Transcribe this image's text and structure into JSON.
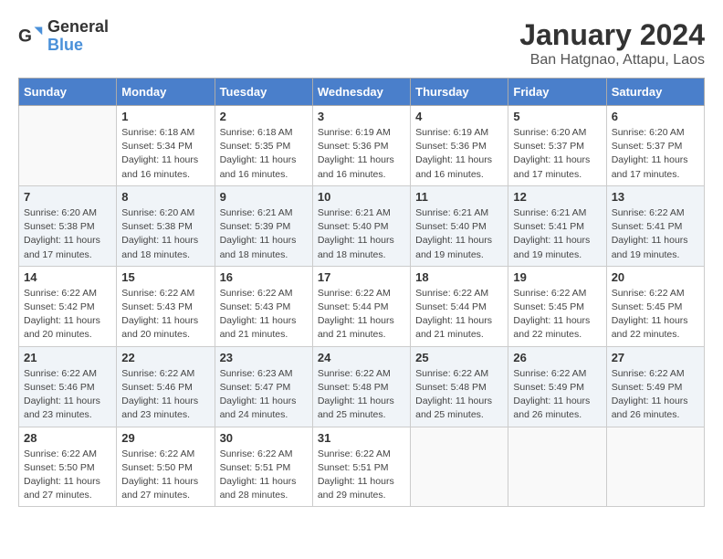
{
  "header": {
    "logo_general": "General",
    "logo_blue": "Blue",
    "month": "January 2024",
    "location": "Ban Hatgnao, Attapu, Laos"
  },
  "weekdays": [
    "Sunday",
    "Monday",
    "Tuesday",
    "Wednesday",
    "Thursday",
    "Friday",
    "Saturday"
  ],
  "weeks": [
    [
      {
        "day": "",
        "info": ""
      },
      {
        "day": "1",
        "info": "Sunrise: 6:18 AM\nSunset: 5:34 PM\nDaylight: 11 hours\nand 16 minutes."
      },
      {
        "day": "2",
        "info": "Sunrise: 6:18 AM\nSunset: 5:35 PM\nDaylight: 11 hours\nand 16 minutes."
      },
      {
        "day": "3",
        "info": "Sunrise: 6:19 AM\nSunset: 5:36 PM\nDaylight: 11 hours\nand 16 minutes."
      },
      {
        "day": "4",
        "info": "Sunrise: 6:19 AM\nSunset: 5:36 PM\nDaylight: 11 hours\nand 16 minutes."
      },
      {
        "day": "5",
        "info": "Sunrise: 6:20 AM\nSunset: 5:37 PM\nDaylight: 11 hours\nand 17 minutes."
      },
      {
        "day": "6",
        "info": "Sunrise: 6:20 AM\nSunset: 5:37 PM\nDaylight: 11 hours\nand 17 minutes."
      }
    ],
    [
      {
        "day": "7",
        "info": "Sunrise: 6:20 AM\nSunset: 5:38 PM\nDaylight: 11 hours\nand 17 minutes."
      },
      {
        "day": "8",
        "info": "Sunrise: 6:20 AM\nSunset: 5:38 PM\nDaylight: 11 hours\nand 18 minutes."
      },
      {
        "day": "9",
        "info": "Sunrise: 6:21 AM\nSunset: 5:39 PM\nDaylight: 11 hours\nand 18 minutes."
      },
      {
        "day": "10",
        "info": "Sunrise: 6:21 AM\nSunset: 5:40 PM\nDaylight: 11 hours\nand 18 minutes."
      },
      {
        "day": "11",
        "info": "Sunrise: 6:21 AM\nSunset: 5:40 PM\nDaylight: 11 hours\nand 19 minutes."
      },
      {
        "day": "12",
        "info": "Sunrise: 6:21 AM\nSunset: 5:41 PM\nDaylight: 11 hours\nand 19 minutes."
      },
      {
        "day": "13",
        "info": "Sunrise: 6:22 AM\nSunset: 5:41 PM\nDaylight: 11 hours\nand 19 minutes."
      }
    ],
    [
      {
        "day": "14",
        "info": "Sunrise: 6:22 AM\nSunset: 5:42 PM\nDaylight: 11 hours\nand 20 minutes."
      },
      {
        "day": "15",
        "info": "Sunrise: 6:22 AM\nSunset: 5:43 PM\nDaylight: 11 hours\nand 20 minutes."
      },
      {
        "day": "16",
        "info": "Sunrise: 6:22 AM\nSunset: 5:43 PM\nDaylight: 11 hours\nand 21 minutes."
      },
      {
        "day": "17",
        "info": "Sunrise: 6:22 AM\nSunset: 5:44 PM\nDaylight: 11 hours\nand 21 minutes."
      },
      {
        "day": "18",
        "info": "Sunrise: 6:22 AM\nSunset: 5:44 PM\nDaylight: 11 hours\nand 21 minutes."
      },
      {
        "day": "19",
        "info": "Sunrise: 6:22 AM\nSunset: 5:45 PM\nDaylight: 11 hours\nand 22 minutes."
      },
      {
        "day": "20",
        "info": "Sunrise: 6:22 AM\nSunset: 5:45 PM\nDaylight: 11 hours\nand 22 minutes."
      }
    ],
    [
      {
        "day": "21",
        "info": "Sunrise: 6:22 AM\nSunset: 5:46 PM\nDaylight: 11 hours\nand 23 minutes."
      },
      {
        "day": "22",
        "info": "Sunrise: 6:22 AM\nSunset: 5:46 PM\nDaylight: 11 hours\nand 23 minutes."
      },
      {
        "day": "23",
        "info": "Sunrise: 6:23 AM\nSunset: 5:47 PM\nDaylight: 11 hours\nand 24 minutes."
      },
      {
        "day": "24",
        "info": "Sunrise: 6:22 AM\nSunset: 5:48 PM\nDaylight: 11 hours\nand 25 minutes."
      },
      {
        "day": "25",
        "info": "Sunrise: 6:22 AM\nSunset: 5:48 PM\nDaylight: 11 hours\nand 25 minutes."
      },
      {
        "day": "26",
        "info": "Sunrise: 6:22 AM\nSunset: 5:49 PM\nDaylight: 11 hours\nand 26 minutes."
      },
      {
        "day": "27",
        "info": "Sunrise: 6:22 AM\nSunset: 5:49 PM\nDaylight: 11 hours\nand 26 minutes."
      }
    ],
    [
      {
        "day": "28",
        "info": "Sunrise: 6:22 AM\nSunset: 5:50 PM\nDaylight: 11 hours\nand 27 minutes."
      },
      {
        "day": "29",
        "info": "Sunrise: 6:22 AM\nSunset: 5:50 PM\nDaylight: 11 hours\nand 27 minutes."
      },
      {
        "day": "30",
        "info": "Sunrise: 6:22 AM\nSunset: 5:51 PM\nDaylight: 11 hours\nand 28 minutes."
      },
      {
        "day": "31",
        "info": "Sunrise: 6:22 AM\nSunset: 5:51 PM\nDaylight: 11 hours\nand 29 minutes."
      },
      {
        "day": "",
        "info": ""
      },
      {
        "day": "",
        "info": ""
      },
      {
        "day": "",
        "info": ""
      }
    ]
  ]
}
